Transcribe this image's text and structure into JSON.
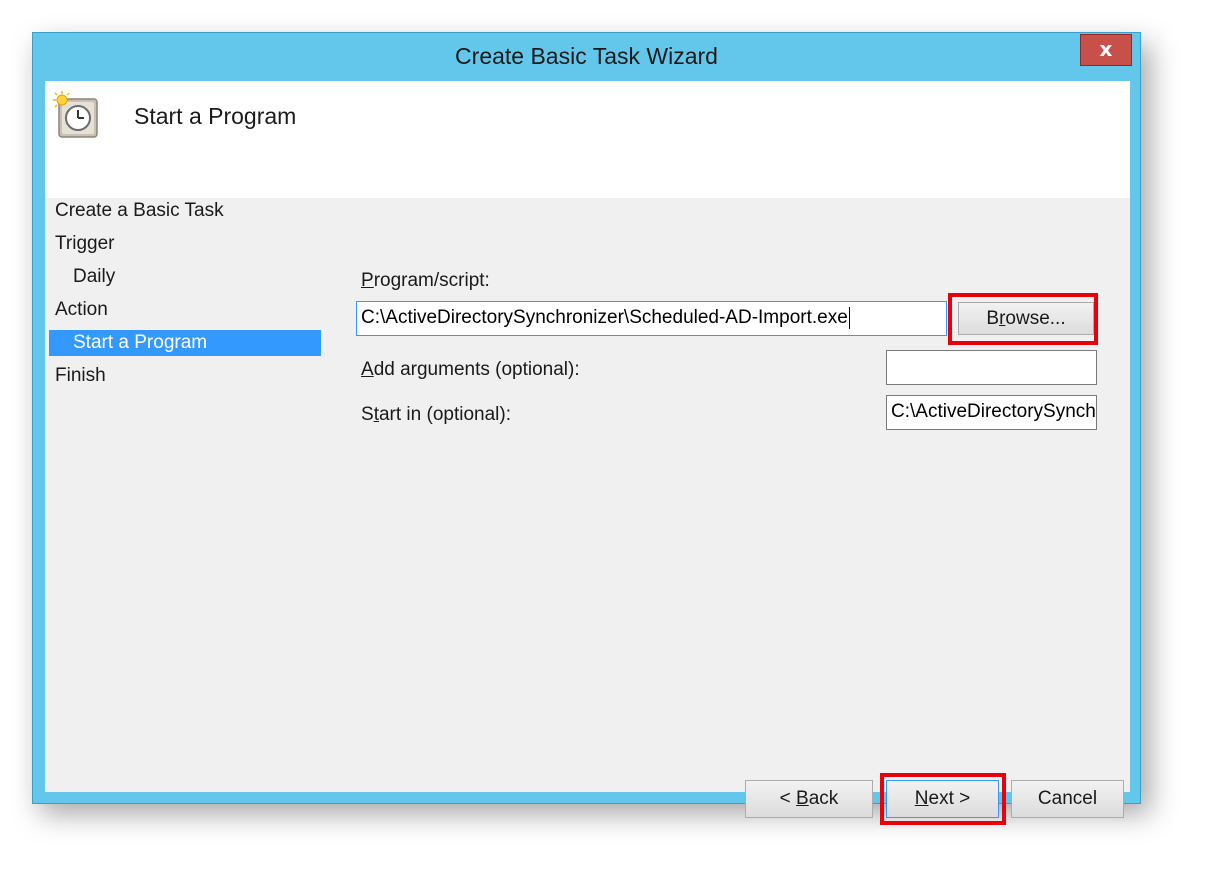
{
  "window": {
    "title": "Create Basic Task Wizard",
    "close_glyph": "x"
  },
  "header": {
    "title": "Start a Program",
    "icon": "scheduled-task-clock-icon"
  },
  "steps": [
    {
      "label": "Create a Basic Task",
      "selected": false
    },
    {
      "label": "Trigger",
      "selected": false
    },
    {
      "label": "Daily",
      "selected": false
    },
    {
      "label": "Action",
      "selected": false
    },
    {
      "label": "Start a Program",
      "selected": true
    },
    {
      "label": "Finish",
      "selected": false
    }
  ],
  "form": {
    "program_label_mnemonic": "P",
    "program_label_rest": "rogram/script:",
    "program_value": "C:\\ActiveDirectorySynchronizer\\Scheduled-AD-Import.exe",
    "browse_mnemonic_pre": "B",
    "browse_mnemonic": "r",
    "browse_rest": "owse...",
    "args_label_mnemonic": "A",
    "args_label_rest": "dd arguments (optional):",
    "args_value": "",
    "startin_label_pre": "S",
    "startin_label_mnemonic": "t",
    "startin_label_rest": "art in (optional):",
    "startin_value": "C:\\ActiveDirectorySynch"
  },
  "buttons": {
    "back_pre": "< ",
    "back_mnemonic": "B",
    "back_rest": "ack",
    "next_mnemonic": "N",
    "next_rest": "ext >",
    "cancel": "Cancel"
  },
  "colors": {
    "frame": "#63c7ec",
    "selection": "#3399ff",
    "highlight": "#e8000b",
    "close": "#c7504b"
  }
}
